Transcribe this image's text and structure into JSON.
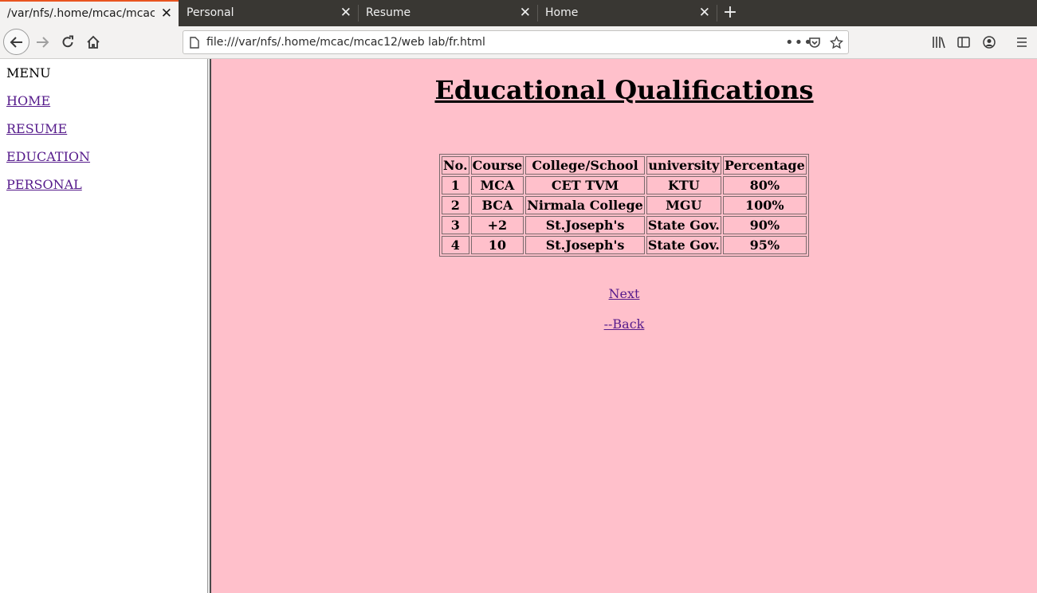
{
  "browser": {
    "tabs": [
      {
        "title": "/var/nfs/.home/mcac/mcac",
        "active": true
      },
      {
        "title": "Personal",
        "active": false
      },
      {
        "title": "Resume",
        "active": false
      },
      {
        "title": "Home",
        "active": false
      }
    ],
    "url": "file:///var/nfs/.home/mcac/mcac12/web lab/fr.html",
    "accent_color": "#e95420"
  },
  "sidebar": {
    "title": "MENU",
    "links": [
      "HOME",
      "RESUME",
      "EDUCATION",
      "PERSONAL"
    ]
  },
  "main": {
    "heading": "Educational Qualifications",
    "background": "#ffc0cb",
    "table": {
      "headers": [
        "No.",
        "Course",
        "College/School",
        "university",
        "Percentage"
      ],
      "rows": [
        [
          "1",
          "MCA",
          "CET TVM",
          "KTU",
          "80%"
        ],
        [
          "2",
          "BCA",
          "Nirmala College",
          "MGU",
          "100%"
        ],
        [
          "3",
          "+2",
          "St.Joseph's",
          "State Gov.",
          "90%"
        ],
        [
          "4",
          "10",
          "St.Joseph's",
          "State Gov.",
          "95%"
        ]
      ]
    },
    "next_link": "Next",
    "back_link": "--Back"
  }
}
